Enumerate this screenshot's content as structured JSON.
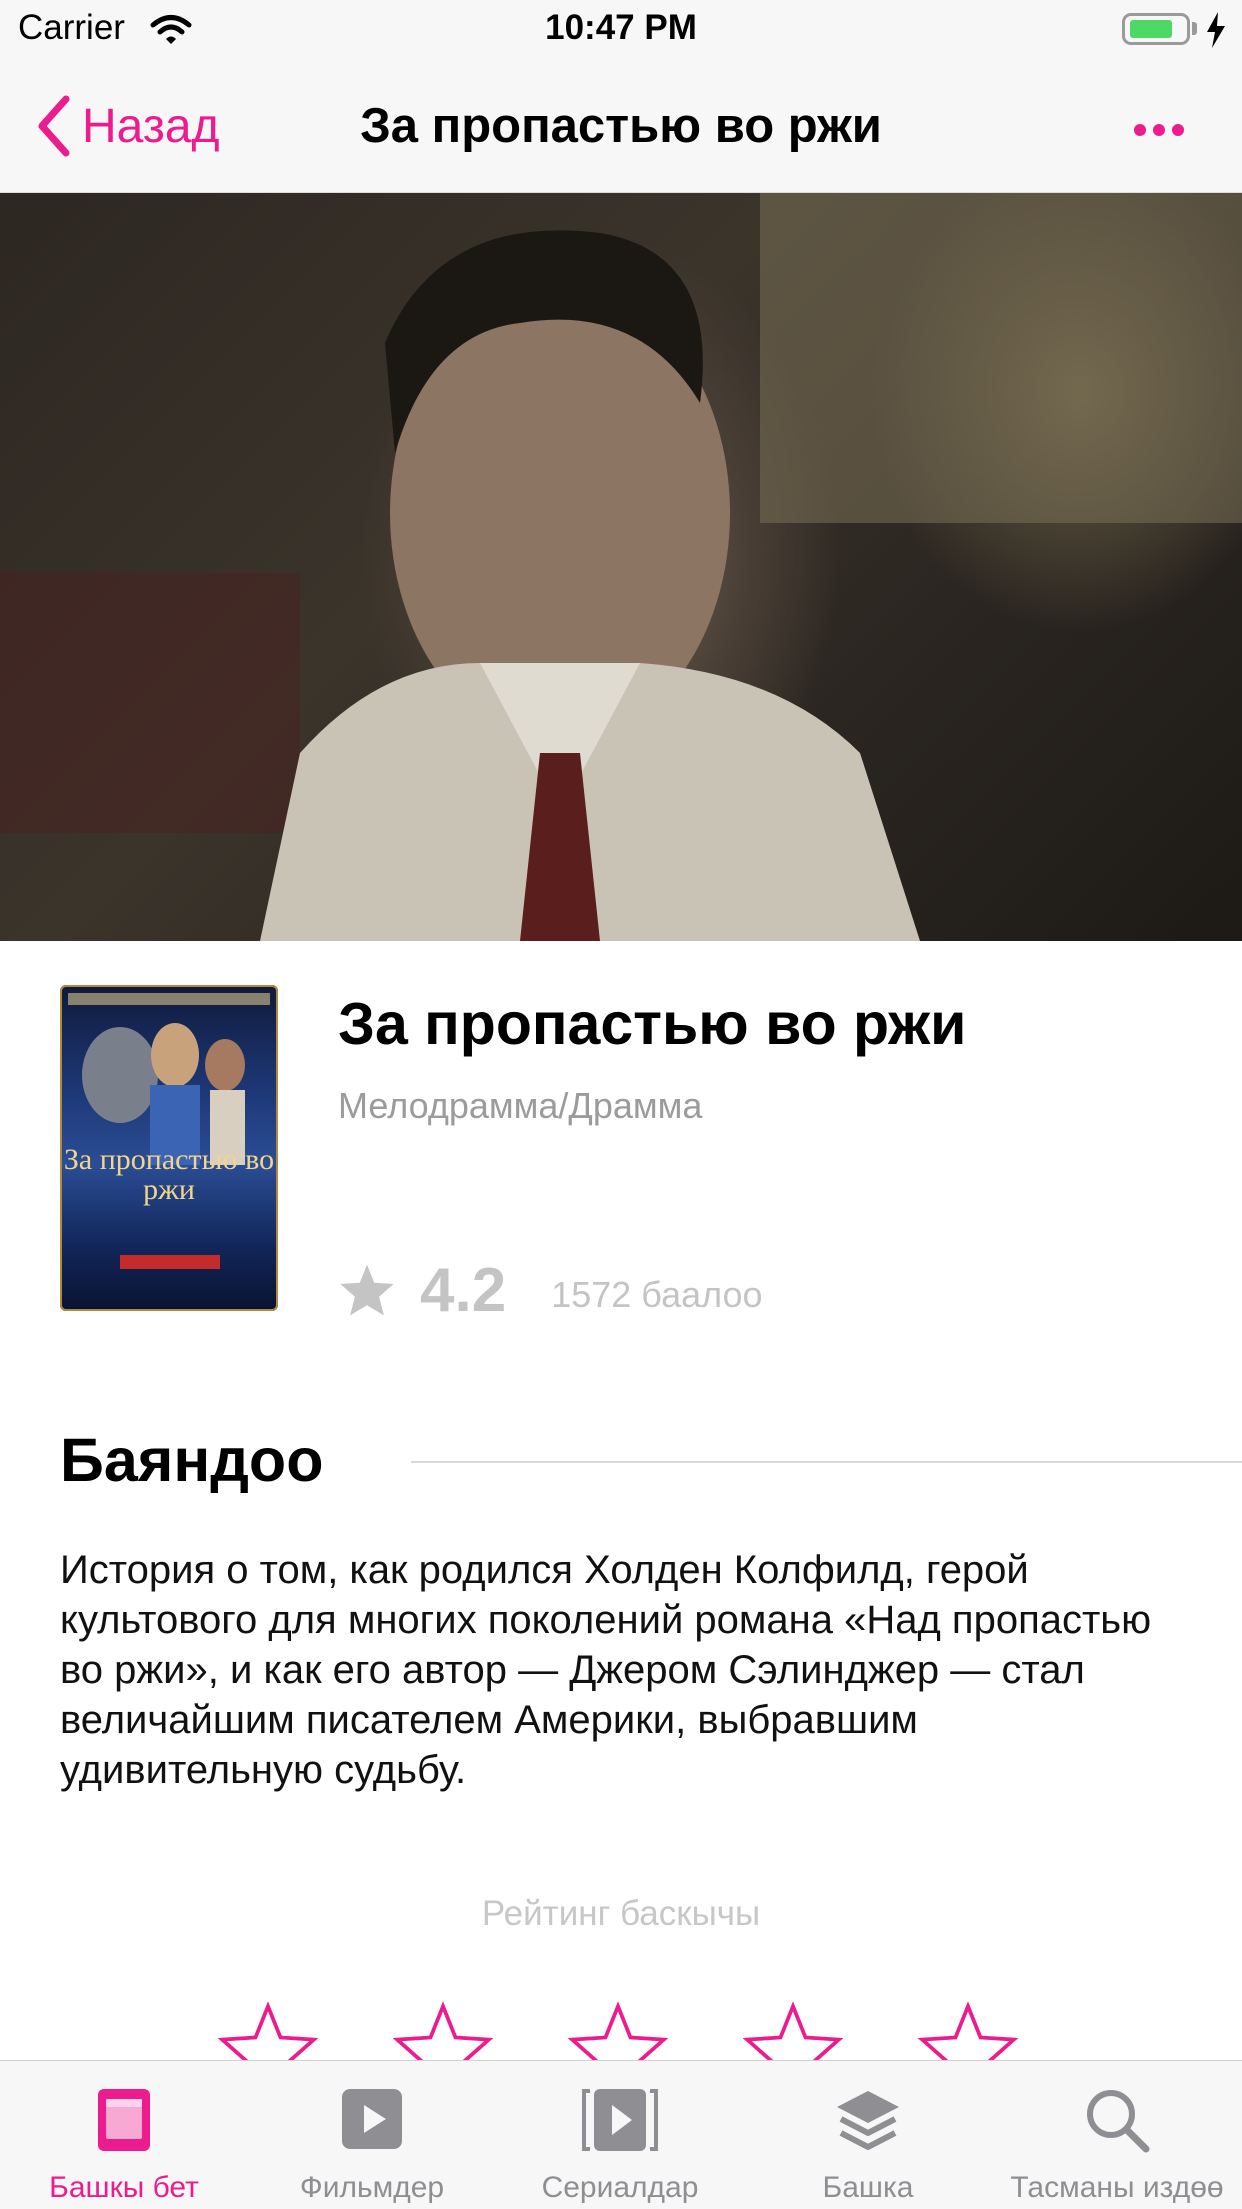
{
  "status_bar": {
    "carrier": "Carrier",
    "time": "10:47 PM"
  },
  "nav": {
    "back_label": "Назад",
    "title": "За пропастью во ржи"
  },
  "movie": {
    "title": "За пропастью во ржи",
    "genre": "Мелодрамма/Драмма",
    "rating": "4.2",
    "votes": "1572 баалоо",
    "poster_text": "За пропастью во ржи"
  },
  "description": {
    "heading": "Баяндоо",
    "text": "История о том, как родился Холден Колфилд, герой культового для многих поколений романа «Над пропастью во ржи», и как его автор — Джером Сэлинджер — стал величайшим писателем Америки, выбравшим удивительную судьбу."
  },
  "rate": {
    "label": "Рейтинг баскычы",
    "stars": 5
  },
  "tabs": [
    {
      "label": "Башкы бет",
      "icon": "home-icon",
      "active": true
    },
    {
      "label": "Фильмдер",
      "icon": "play-icon",
      "active": false
    },
    {
      "label": "Сериалдар",
      "icon": "series-icon",
      "active": false
    },
    {
      "label": "Башка",
      "icon": "layers-icon",
      "active": false
    },
    {
      "label": "Тасманы издөө",
      "icon": "search-icon",
      "active": false
    }
  ],
  "colors": {
    "accent": "#ec1b8e",
    "inactive": "#8e8e93",
    "muted": "#c4c4c4"
  }
}
